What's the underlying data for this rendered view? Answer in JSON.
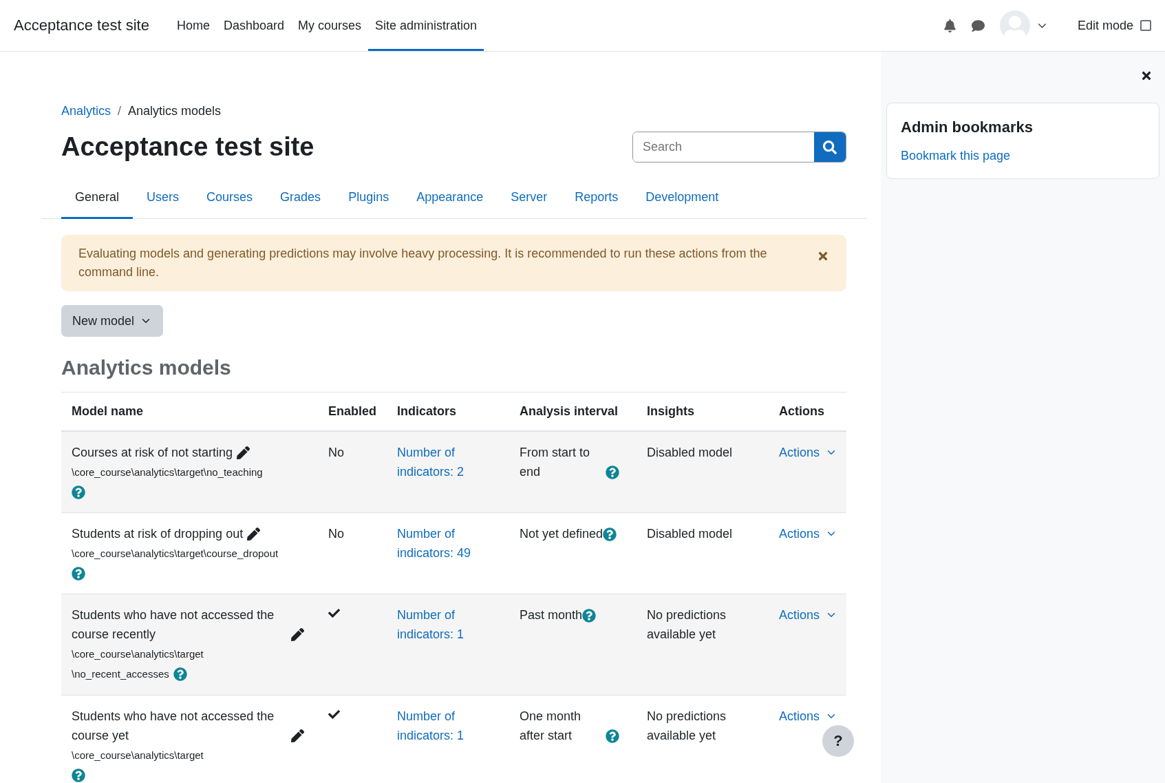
{
  "navbar": {
    "site_name": "Acceptance test site",
    "links": [
      {
        "label": "Home",
        "selected": false
      },
      {
        "label": "Dashboard",
        "selected": false
      },
      {
        "label": "My courses",
        "selected": false
      },
      {
        "label": "Site administration",
        "selected": true
      }
    ],
    "edit_mode": {
      "label": "Edit mode",
      "checked": false
    }
  },
  "breadcrumb": {
    "items": [
      "Analytics",
      "Analytics models"
    ],
    "separator": "/"
  },
  "page_title": "Acceptance test site",
  "search": {
    "placeholder": "Search"
  },
  "tabs": [
    {
      "label": "General",
      "selected": true
    },
    {
      "label": "Users",
      "selected": false
    },
    {
      "label": "Courses",
      "selected": false
    },
    {
      "label": "Grades",
      "selected": false
    },
    {
      "label": "Plugins",
      "selected": false
    },
    {
      "label": "Appearance",
      "selected": false
    },
    {
      "label": "Server",
      "selected": false
    },
    {
      "label": "Reports",
      "selected": false
    },
    {
      "label": "Development",
      "selected": false
    }
  ],
  "alert": {
    "text": "Evaluating models and generating predictions may involve heavy processing. It is recommended to run these actions from the command line."
  },
  "new_model_button": "New model",
  "section_heading": "Analytics models",
  "table": {
    "columns": [
      "Model name",
      "Enabled",
      "Indicators",
      "Analysis interval",
      "Insights",
      "Actions"
    ],
    "rows": [
      {
        "name": "Courses at risk of not starting",
        "path": [
          "\\core_course\\analytics\\target\\no_teaching"
        ],
        "enabled": false,
        "enabled_text": "No",
        "indicators": "Number of indicators: 2",
        "interval": "From start to end",
        "insights": "Disabled model",
        "actions": "Actions"
      },
      {
        "name": "Students at risk of dropping out",
        "path": [
          "\\core_course\\analytics\\target\\course_dropout"
        ],
        "enabled": false,
        "enabled_text": "No",
        "indicators": "Number of indicators: 49",
        "interval": "Not yet defined",
        "insights": "Disabled model",
        "actions": "Actions"
      },
      {
        "name": "Students who have not accessed the course recently",
        "path": [
          "\\core_course\\analytics\\target",
          "\\no_recent_accesses"
        ],
        "enabled": true,
        "indicators": "Number of indicators: 1",
        "interval": "Past month",
        "insights": "No predictions available yet",
        "actions": "Actions"
      },
      {
        "name": "Students who have not accessed the course yet",
        "path": [
          "\\core_course\\analytics\\target"
        ],
        "enabled": true,
        "indicators": "Number of indicators: 1",
        "interval": "One month after start",
        "insights": "No predictions available yet",
        "actions": "Actions"
      }
    ]
  },
  "drawer": {
    "title": "Admin bookmarks",
    "link": "Bookmark this page"
  },
  "help_button": "?"
}
